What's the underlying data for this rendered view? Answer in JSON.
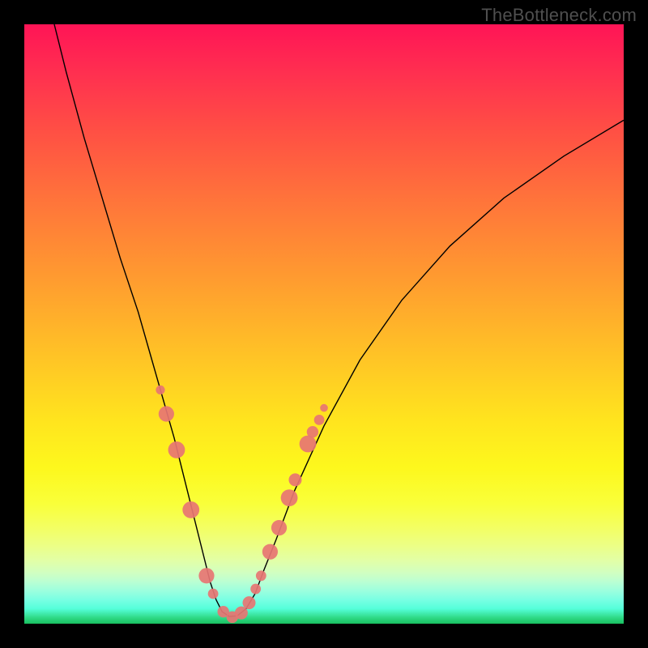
{
  "watermark": "TheBottleneck.com",
  "chart_data": {
    "type": "line",
    "title": "",
    "xlabel": "",
    "ylabel": "",
    "xlim": [
      0,
      100
    ],
    "ylim": [
      0,
      100
    ],
    "grid": false,
    "legend": false,
    "series": [
      {
        "name": "curve",
        "stroke": "#000000",
        "stroke_width": 1.4,
        "x": [
          5,
          7,
          10,
          13,
          16,
          19,
          21,
          23,
          25,
          27,
          28.5,
          30,
          31,
          32,
          33,
          34.2,
          35.5,
          37,
          38.5,
          40,
          42,
          45,
          50,
          56,
          63,
          71,
          80,
          90,
          100
        ],
        "y": [
          100,
          92,
          81,
          71,
          61,
          52,
          45,
          38,
          31,
          23,
          17,
          11,
          7,
          4,
          2,
          1.2,
          1.3,
          2.5,
          5,
          9,
          14,
          22,
          33,
          44,
          54,
          63,
          71,
          78,
          84
        ]
      }
    ],
    "markers": {
      "fill": "#e77573",
      "opacity": 0.92,
      "points": [
        {
          "x": 22.7,
          "y": 39,
          "r": 3.5
        },
        {
          "x": 23.7,
          "y": 35,
          "r": 6
        },
        {
          "x": 25.4,
          "y": 29,
          "r": 6.5
        },
        {
          "x": 27.8,
          "y": 19,
          "r": 6.5
        },
        {
          "x": 30.4,
          "y": 8,
          "r": 6
        },
        {
          "x": 31.5,
          "y": 5,
          "r": 4
        },
        {
          "x": 33.2,
          "y": 2,
          "r": 4.5
        },
        {
          "x": 34.7,
          "y": 1.1,
          "r": 4.5
        },
        {
          "x": 36.2,
          "y": 1.8,
          "r": 5
        },
        {
          "x": 37.5,
          "y": 3.5,
          "r": 5
        },
        {
          "x": 38.6,
          "y": 5.8,
          "r": 4
        },
        {
          "x": 39.5,
          "y": 8,
          "r": 4
        },
        {
          "x": 41.0,
          "y": 12,
          "r": 6
        },
        {
          "x": 42.5,
          "y": 16,
          "r": 6
        },
        {
          "x": 44.2,
          "y": 21,
          "r": 6.5
        },
        {
          "x": 45.2,
          "y": 24,
          "r": 5
        },
        {
          "x": 47.3,
          "y": 30,
          "r": 6.5
        },
        {
          "x": 48.1,
          "y": 32,
          "r": 4.5
        },
        {
          "x": 49.2,
          "y": 34,
          "r": 4
        },
        {
          "x": 50.0,
          "y": 36,
          "r": 3
        }
      ]
    }
  }
}
